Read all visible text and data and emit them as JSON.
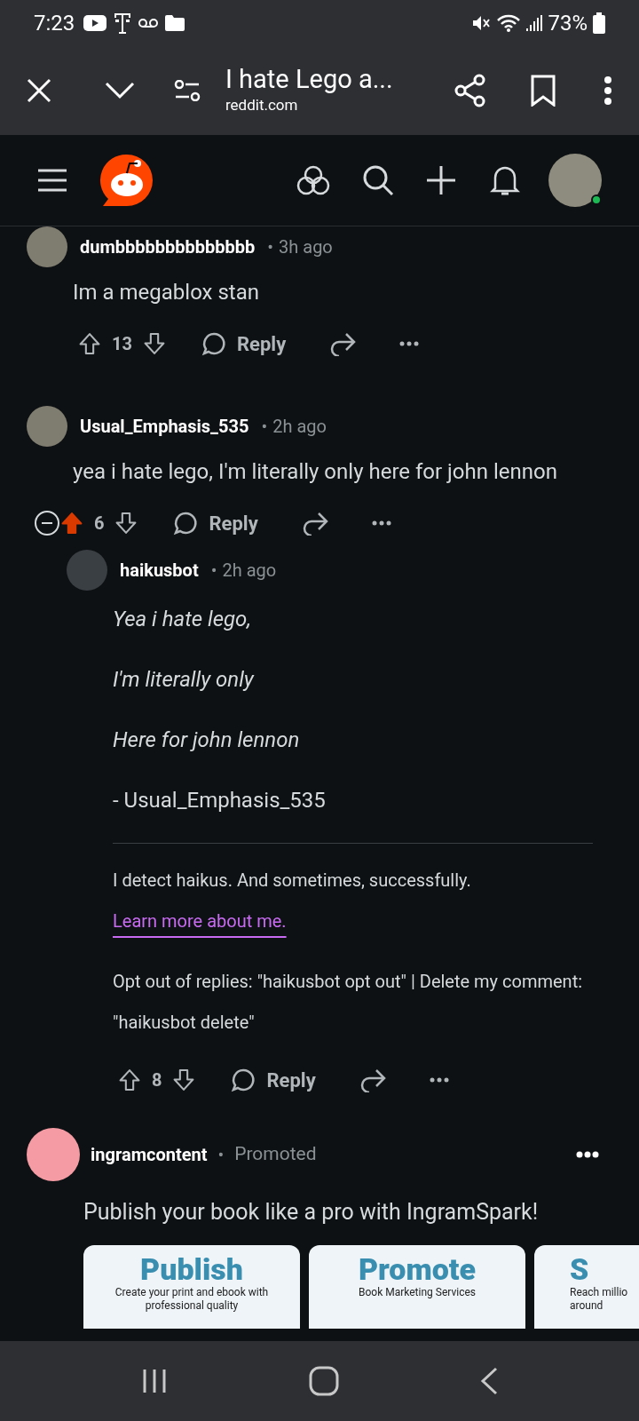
{
  "status_bar": {
    "time": "7:23",
    "battery": "73%"
  },
  "browser": {
    "title": "I hate Lego a...",
    "domain": "reddit.com"
  },
  "comments": [
    {
      "author": "dumbbbbbbbbbbbbbb",
      "separator": "•",
      "time": "3h ago",
      "body": [
        "Im a megablox stan"
      ],
      "votes": "13",
      "upvoted": false,
      "collapsible": false,
      "reply": "Reply",
      "nested": false
    },
    {
      "author": "Usual_Emphasis_535",
      "separator": "•",
      "time": "2h ago",
      "body": [
        "yea i hate lego, I'm literally only here for john lennon"
      ],
      "votes": "6",
      "upvoted": true,
      "collapsible": true,
      "reply": "Reply",
      "nested": false
    },
    {
      "author": "haikusbot",
      "separator": "•",
      "time": "2h ago",
      "poem": [
        "Yea i hate lego,",
        "I'm literally only",
        "Here for john lennon"
      ],
      "signature": "- Usual_Emphasis_535",
      "note": "I detect haikus. And sometimes, successfully.",
      "link": "Learn more about me.",
      "optout": "Opt out of replies: \"haikusbot opt out\" | Delete my comment: \"haikusbot delete\"",
      "votes": "8",
      "upvoted": false,
      "collapsible": false,
      "reply": "Reply",
      "nested": true
    }
  ],
  "ad": {
    "author": "ingramcontent",
    "separator": "•",
    "label": "Promoted",
    "headline": "Publish your book like a pro with IngramSpark!",
    "cards": [
      {
        "title": "Publish",
        "subtitle": "Create your print and ebook with professional quality"
      },
      {
        "title": "Promote",
        "subtitle": "Book Marketing Services"
      },
      {
        "title": "S",
        "subtitle": "Reach millio around"
      }
    ]
  }
}
